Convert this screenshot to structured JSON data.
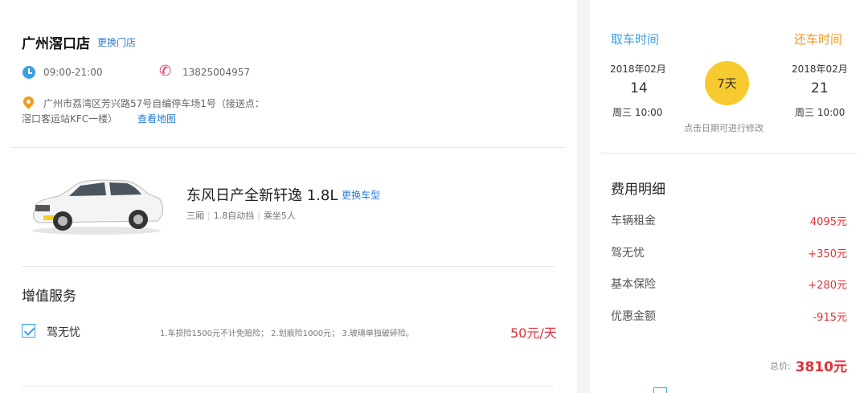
{
  "colors": {
    "accent": "#3aa0e4",
    "link": "#2a7dd6",
    "price": "#e0313a",
    "return": "#f29a1f",
    "badge": "#f7ca2f"
  },
  "store": {
    "name": "广州滘口店",
    "change_label": "更换门店",
    "hours_icon": "clock-icon",
    "hours": "09:00-21:00",
    "phone_icon": "phone-icon",
    "phone": "13825004957",
    "address_icon": "location-pin-icon",
    "address_line1": "广州市荔湾区芳兴路57号自编停车场1号（接送点：",
    "address_line2": "滘口客运站KFC一楼）",
    "map_label": "查看地图"
  },
  "car": {
    "name": "东风日产全新轩逸 1.8L",
    "change_label": "更换车型",
    "specs": [
      "三厢",
      "1.8自动挡",
      "乘坐5人"
    ]
  },
  "services": {
    "title": "增值服务",
    "items": [
      {
        "checked": true,
        "name": "驾无忧",
        "description": "1.车损险1500元不计免赔险； 2.划痕险1000元； 3.玻璃单独破碎险。",
        "price": "50元/天"
      }
    ]
  },
  "rental": {
    "pickup_label": "取车时间",
    "return_label": "还车时间",
    "pickup_year_month": "2018年02月",
    "pickup_day": "14",
    "pickup_time": "周三 10:00",
    "return_year_month": "2018年02月",
    "return_day": "21",
    "return_time": "周三 10:00",
    "duration": "7天",
    "hint": "点击日期可进行修改"
  },
  "fees": {
    "title": "费用明细",
    "items": [
      {
        "label": "车辆租金",
        "value": "4095元"
      },
      {
        "label": "驾无忧",
        "value": "+350元"
      },
      {
        "label": "基本保险",
        "value": "+280元"
      },
      {
        "label": "优惠金额",
        "value": "-915元"
      }
    ],
    "total_label": "总价:",
    "total_value": "3810元"
  }
}
